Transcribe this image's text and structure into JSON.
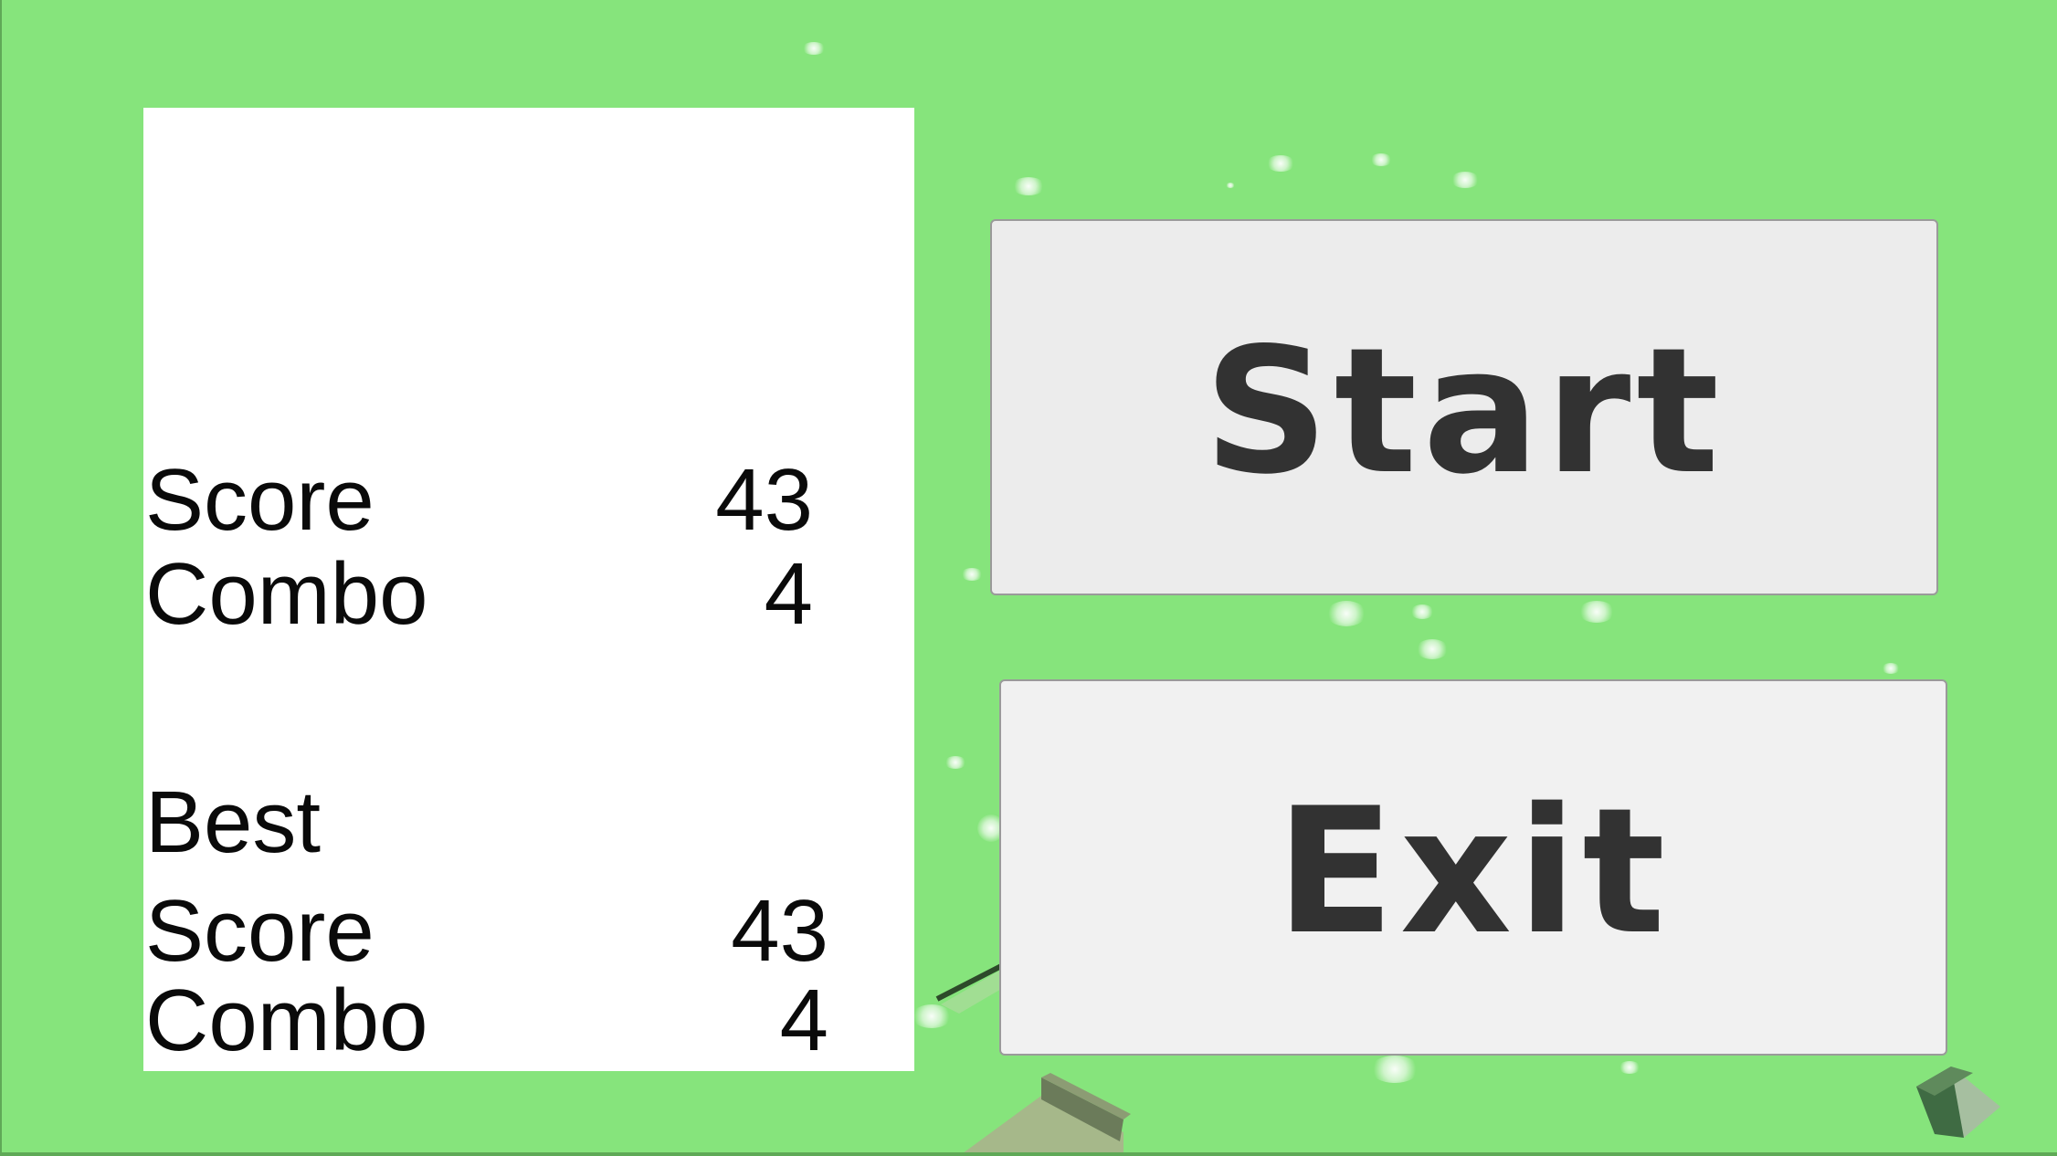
{
  "colors": {
    "background": "#86e47c",
    "panel": "#ffffff",
    "button_bg": "#ececec",
    "button_text": "#323232"
  },
  "stats": {
    "current": {
      "score_label": "Score",
      "score_value": "43",
      "combo_label": "Combo",
      "combo_value": "4"
    },
    "best": {
      "heading": "Best",
      "score_label": "Score",
      "score_value": "43",
      "combo_label": "Combo",
      "combo_value": "4"
    }
  },
  "menu": {
    "start_label": "Start",
    "exit_label": "Exit"
  }
}
